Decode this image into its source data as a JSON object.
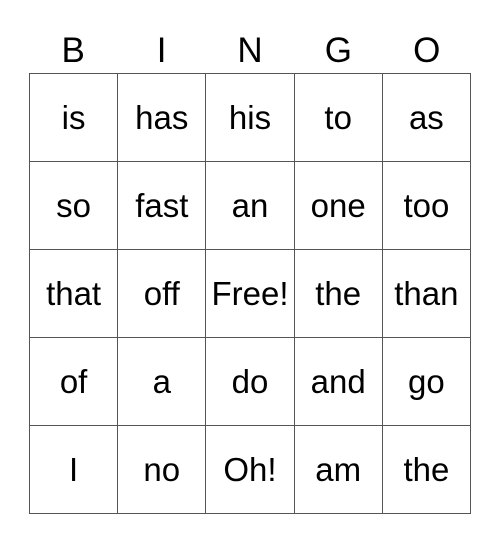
{
  "header": [
    "B",
    "I",
    "N",
    "G",
    "O"
  ],
  "rows": [
    [
      "is",
      "has",
      "his",
      "to",
      "as"
    ],
    [
      "so",
      "fast",
      "an",
      "one",
      "too"
    ],
    [
      "that",
      "off",
      "Free!",
      "the",
      "than"
    ],
    [
      "of",
      "a",
      "do",
      "and",
      "go"
    ],
    [
      "I",
      "no",
      "Oh!",
      "am",
      "the"
    ]
  ]
}
